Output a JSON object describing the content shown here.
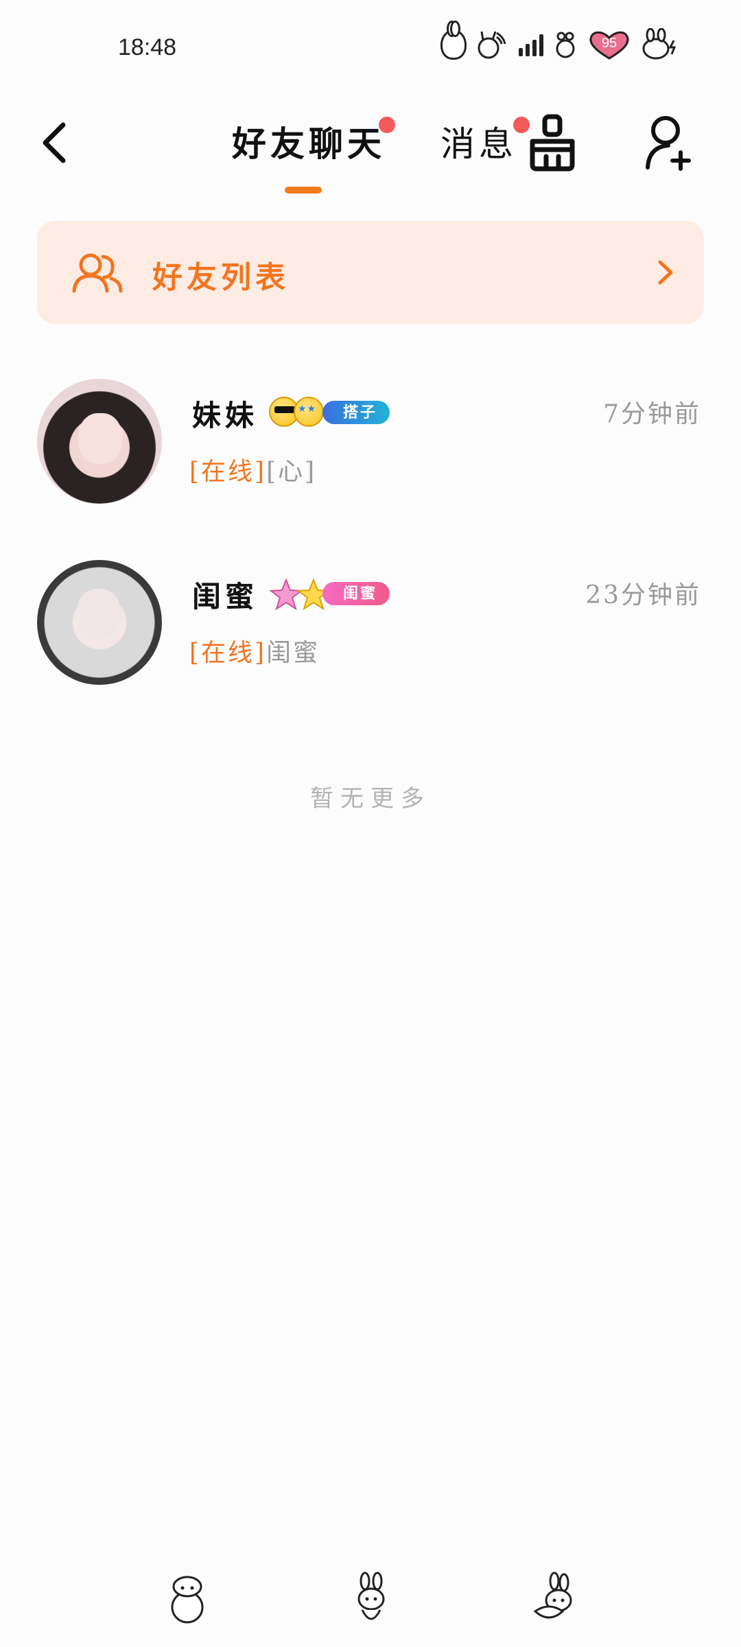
{
  "status_bar": {
    "time": "18:48",
    "battery": "95",
    "icons": [
      "bunny-icon",
      "wifi-bunny-icon",
      "signal-icon",
      "heart-battery-icon",
      "bunny-charging-icon"
    ]
  },
  "header": {
    "tabs": [
      {
        "label": "好友聊天",
        "active": true,
        "has_dot": true
      },
      {
        "label": "消息",
        "active": false,
        "has_dot": true
      }
    ],
    "icons": {
      "back": "chevron-left-icon",
      "clean": "broom-icon",
      "add_friend": "add-user-icon"
    },
    "accent_color": "#f37a1c",
    "dot_color": "#f35a5a"
  },
  "friend_list_banner": {
    "label": "好友列表",
    "icon": "friends-icon",
    "chevron": "chevron-right-icon",
    "background": "#fdece4"
  },
  "chats": [
    {
      "name": "妹妹",
      "badge_label": "搭子",
      "time": "7分钟前",
      "status": "[在线]",
      "preview": "[心]"
    },
    {
      "name": "闺蜜",
      "badge_label": "闺蜜",
      "time": "23分钟前",
      "status": "[在线]",
      "preview": "闺蜜"
    }
  ],
  "list_footer": "暂无更多",
  "bottom_nav": {
    "icons": [
      "nav-back-bunny-icon",
      "nav-home-bunny-icon",
      "nav-recent-bunny-icon"
    ]
  }
}
